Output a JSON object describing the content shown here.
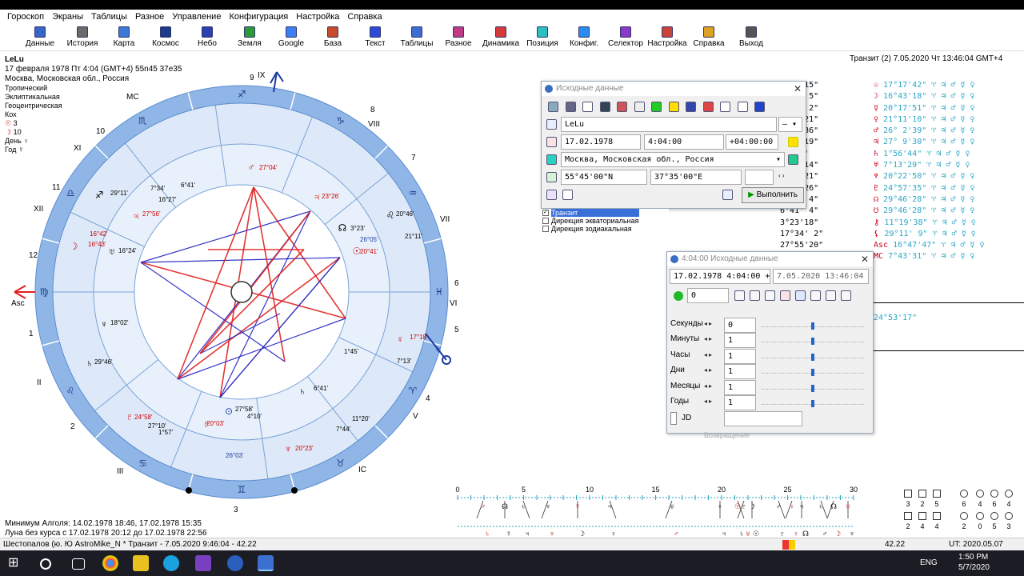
{
  "menu": [
    "Гороскоп",
    "Экраны",
    "Таблицы",
    "Разное",
    "Управление",
    "Конфигурация",
    "Настройка",
    "Справка"
  ],
  "toolbar": [
    {
      "label": "Данные",
      "icon": "data-icon"
    },
    {
      "label": "История",
      "icon": "history-icon"
    },
    {
      "label": "Карта",
      "icon": "chart-icon"
    },
    {
      "label": "Космос",
      "icon": "cosmos-icon"
    },
    {
      "label": "Небо",
      "icon": "sky-icon"
    },
    {
      "label": "Земля",
      "icon": "earth-icon"
    },
    {
      "label": "Google",
      "icon": "google-icon"
    },
    {
      "label": "База",
      "icon": "database-icon"
    },
    {
      "label": "Текст",
      "icon": "text-icon"
    },
    {
      "label": "Таблицы",
      "icon": "tables-icon"
    },
    {
      "label": "Разное",
      "icon": "misc-icon"
    },
    {
      "label": "Динамика",
      "icon": "dynamics-icon"
    },
    {
      "label": "Позиция",
      "icon": "position-icon"
    },
    {
      "label": "Конфиг.",
      "icon": "config-icon"
    },
    {
      "label": "Селектор",
      "icon": "selector-icon"
    },
    {
      "label": "Настройка",
      "icon": "settings-icon"
    },
    {
      "label": "Справка",
      "icon": "help-icon"
    },
    {
      "label": "Выход",
      "icon": "exit-icon"
    }
  ],
  "chart": {
    "name": "LeLu",
    "line1": "17 февраля 1978  Пт  4:04 (GMT+4) 55n45  37e35",
    "line2": "Москва, Московская обл., Россия",
    "meta": [
      "Тропический",
      "Эклиптикальная",
      "Геоцентрическая",
      "Кох"
    ],
    "sun_count": "3",
    "moon_count": "10",
    "day_label": "День",
    "year_label": "Год",
    "house_labels": [
      "Asc",
      "II",
      "III",
      "IC",
      "V",
      "VI",
      "VII",
      "VIII",
      "IX",
      "MC",
      "XI",
      "XII"
    ],
    "house_numbers": [
      "1",
      "2",
      "3",
      "4",
      "5",
      "6",
      "7",
      "8",
      "9",
      "10",
      "11",
      "12"
    ],
    "planet_labels": [
      "27°04'",
      "23°26'",
      "3°23'",
      "20°46'",
      "26°05'",
      "20°41'",
      "21°11'",
      "17°18'",
      "7°13'",
      "1°45'",
      "6°41'",
      "11°20'",
      "7°44'",
      "20°23'",
      "26°03'",
      "27°58'",
      "4°10'",
      "20°03'",
      "27°10'",
      "1°57'",
      "24°58'",
      "29°46'",
      "18°02'",
      "16°24'",
      "16°42'",
      "16°43'",
      "27°56'",
      "16°27'",
      "29°11'",
      "7°34'",
      "6°41'"
    ]
  },
  "bottom_info": {
    "line1": "Минимум Алголя: 14.02.1978 18:46,  17.02.1978 15:35",
    "line2": "Луна без курса с 17.02.1978 20:12 до 17.02.1978 22:56"
  },
  "transit": {
    "header": "Транзит (2)  7.05.2020  Чт 13:46:04 GMT+4",
    "col1": [
      "7°58'15\"",
      "0°41' 5\"",
      "0° 3' 2\"",
      "8°10'21\"",
      "8°25'36\"",
      "5° 5'19\"",
      "3° 54'",
      "5°24'14\"",
      "9° 2'21\"",
      "5°27'26\"",
      "5°41' 4\"",
      "6°41' 4\"",
      "3°23'18\"",
      "17°34' 2\"",
      "27°55'20\"",
      "12° 7'47\""
    ],
    "col2": [
      "17°17'42\"",
      "16°43'18\"",
      "20°17'51\"",
      "21°11'10\"",
      "26° 2'39\"",
      "27° 9'30\"",
      "1°56'44\"",
      "7°13'29\"",
      "20°22'50\"",
      "24°57'35\"",
      "29°46'28\"",
      "29°46'28\"",
      "11°19'38\"",
      "29°11' 9\"",
      "16°47'47\"",
      "7°43'31\""
    ],
    "extra": "24°53'17\""
  },
  "dialog1": {
    "title": "Исходные данные",
    "name_value": "LeLu",
    "name_dropdown": "—",
    "date_value": "17.02.1978",
    "time_value": "4:04:00",
    "tz_value": "+04:00:00",
    "place_value": "Москва, Московская обл., Россия",
    "lat_value": "55°45'00\"N",
    "lon_value": "37°35'00\"E",
    "run_button": "Выполнить",
    "checklist": [
      "Транзит",
      "Дирекция экваториальная",
      "Дирекция зодиакальная"
    ]
  },
  "dialog2": {
    "title": "4:04:00 Исходные данные",
    "natal_value": "17.02.1978  4:04:00  +4",
    "transit_value": "7.05.2020  13:46:04  +4",
    "step_value": "0",
    "rows": [
      {
        "label": "Секунды",
        "value": "0"
      },
      {
        "label": "Минуты",
        "value": "1"
      },
      {
        "label": "Часы",
        "value": "1"
      },
      {
        "label": "Дни",
        "value": "1"
      },
      {
        "label": "Месяцы",
        "value": "1"
      },
      {
        "label": "Годы",
        "value": "1"
      }
    ],
    "jd_label": "JD",
    "return_label": "Возвращение"
  },
  "ephemeris_scale": [
    "0",
    "5",
    "10",
    "15",
    "20",
    "25",
    "30"
  ],
  "aspect_counts_top": [
    "3",
    "2",
    "5",
    "6",
    "4",
    "6",
    "4"
  ],
  "aspect_counts_bottom": [
    "2",
    "4",
    "4",
    "2",
    "0",
    "5",
    "3"
  ],
  "status": {
    "left": "Шестопалов (ю. Ю AstroMike_N * Транзит - 7.05.2020 9:46:04 - 42.22",
    "value": "42.22",
    "utc": "UT: 2020.05.07  9:50:44"
  },
  "taskbar": {
    "lang": "ENG",
    "time": "1:50 PM",
    "date": "5/7/2020"
  }
}
